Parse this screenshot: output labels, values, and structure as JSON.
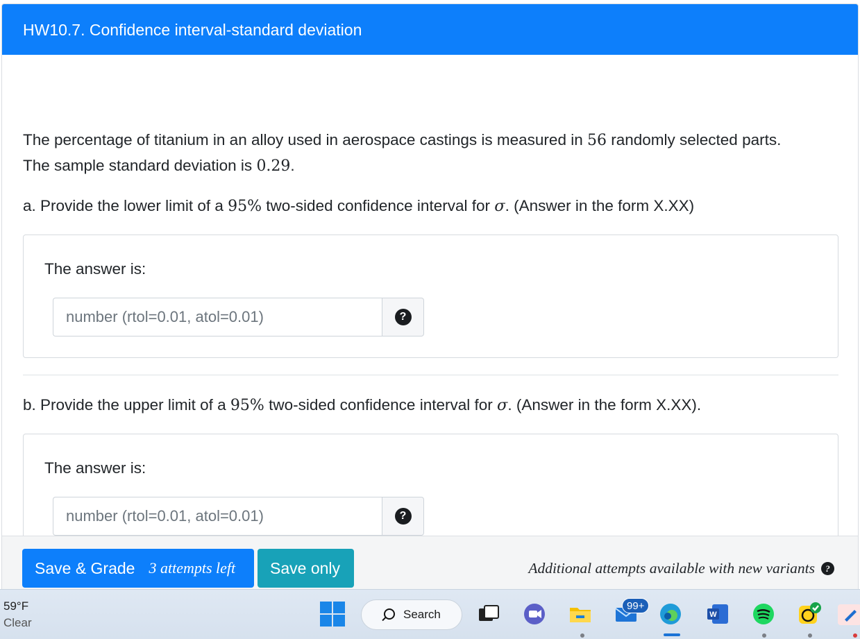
{
  "header": {
    "title": "HW10.7. Confidence interval-standard deviation"
  },
  "problem": {
    "intro_1": "The percentage of titanium in an alloy used in aerospace castings is measured in ",
    "sample_size": "56",
    "intro_2": " randomly selected parts.",
    "intro_3": "The sample standard deviation is ",
    "sample_sd": "0.29",
    "intro_4": "."
  },
  "part_a": {
    "prefix": "a. Provide the lower limit of a ",
    "confidence": "95%",
    "mid": " two-sided confidence interval for ",
    "symbol": "σ",
    "suffix": ". (Answer in the form X.XX)",
    "answer_label": "The answer is:",
    "placeholder": "number (rtol=0.01, atol=0.01)",
    "value": ""
  },
  "part_b": {
    "prefix": "b. Provide the upper limit of a ",
    "confidence": "95%",
    "mid": " two-sided confidence interval for ",
    "symbol": "σ",
    "suffix": ". (Answer in the form X.XX).",
    "answer_label": "The answer is:",
    "placeholder": "number (rtol=0.01, atol=0.01)",
    "value": ""
  },
  "help_icon": "question-circle-icon",
  "footer": {
    "save_grade_label": "Save & Grade",
    "attempts_left": "3 attempts left",
    "save_only_label": "Save only",
    "additional_text": "Additional attempts available with new variants"
  },
  "taskbar": {
    "temperature": "59°F",
    "condition": "Clear",
    "search_label": "Search",
    "mail_badge": "99+",
    "icons": [
      "windows-start-icon",
      "search-icon",
      "task-view-icon",
      "meet-icon",
      "file-explorer-icon",
      "mail-icon",
      "edge-icon",
      "word-icon",
      "spotify-icon",
      "tasks-check-icon",
      "whiteboard-icon"
    ]
  },
  "colors": {
    "primary": "#0d7ffb",
    "info": "#18a2b8",
    "footer_bg": "#f4f5f6"
  }
}
